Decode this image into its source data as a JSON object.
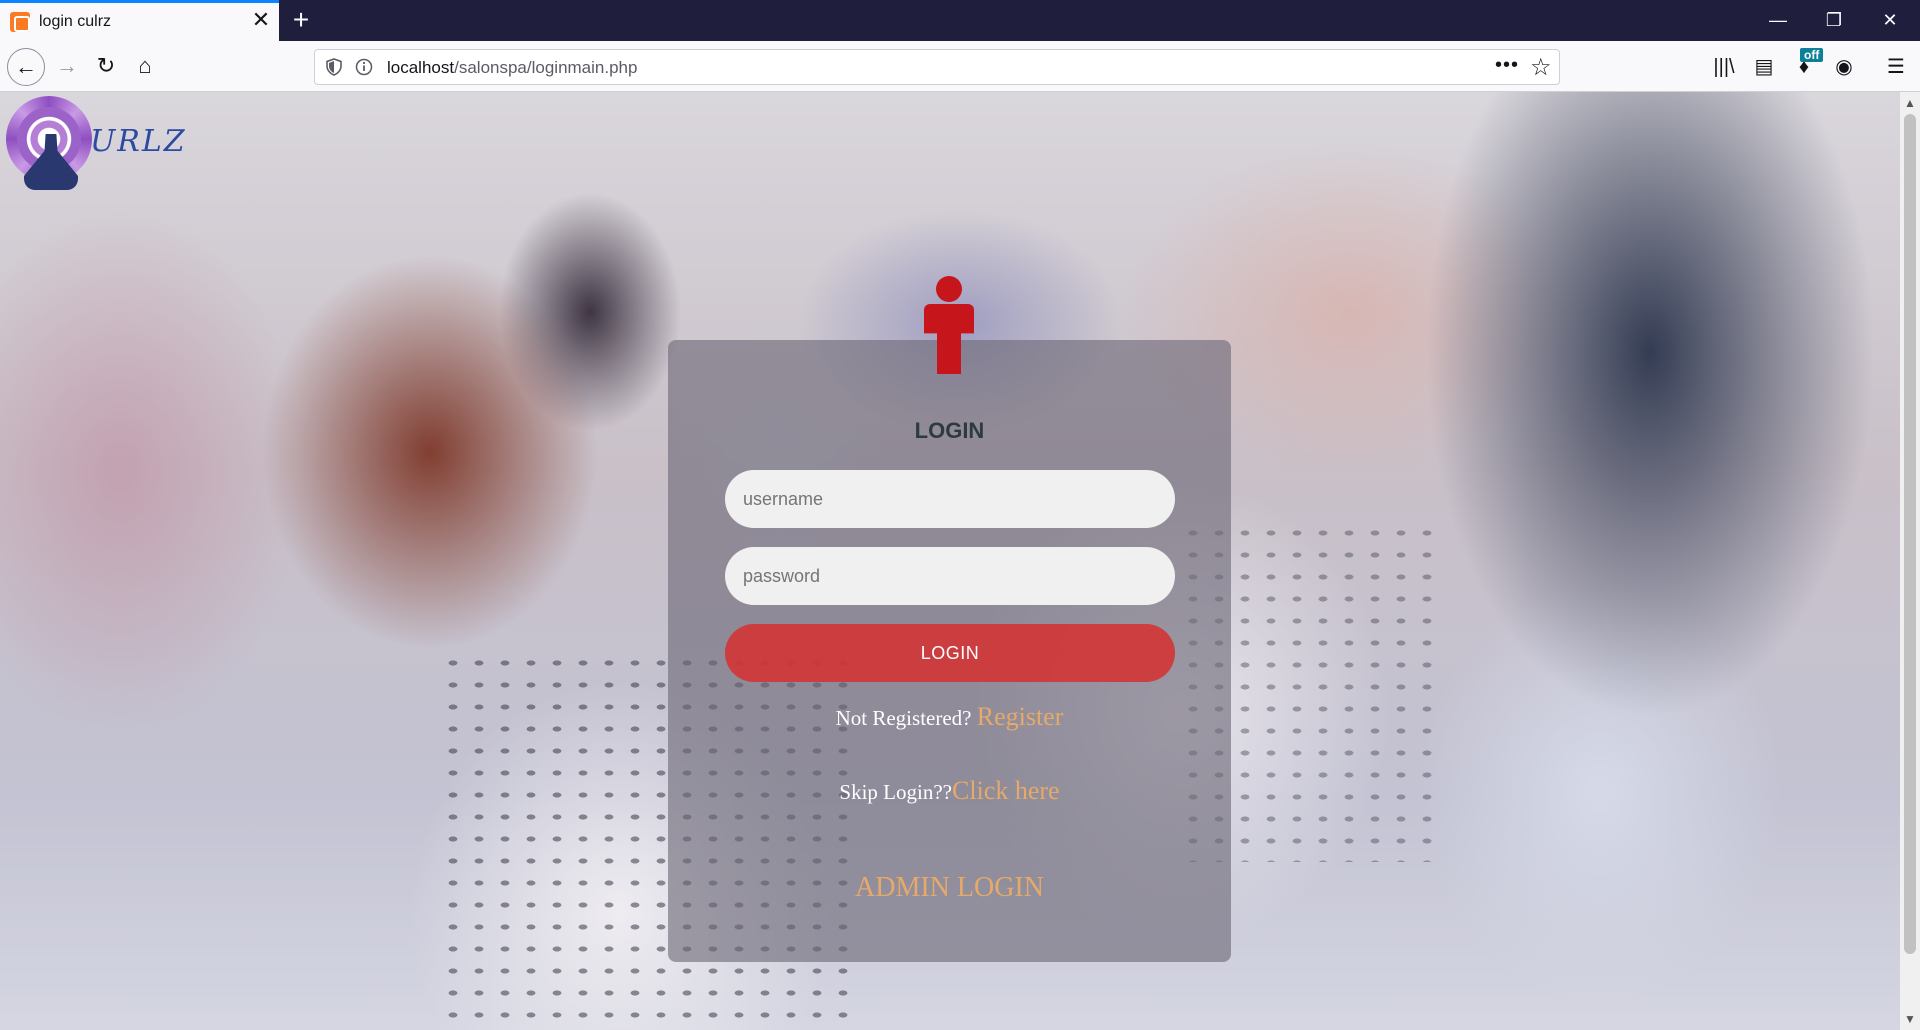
{
  "browser": {
    "tab": {
      "title": "login culrz",
      "close": "✕"
    },
    "new_tab": "+",
    "window": {
      "minimize": "—",
      "restore": "❐",
      "close": "✕"
    },
    "nav": {
      "back": "←",
      "forward": "→",
      "reload": "↻",
      "home": "⌂"
    },
    "url": {
      "host": "localhost",
      "path": "/salonspa/loginmain.php"
    },
    "url_actions": {
      "more": "•••",
      "bookmark": "☆"
    },
    "toolbar": {
      "library": "|||\\",
      "sidebar": "▤",
      "extension": "♦",
      "extension_badge": "off",
      "account": "◉",
      "menu": "☰"
    }
  },
  "logo": {
    "wordmark": "URLZ"
  },
  "login": {
    "heading": "LOGIN",
    "username_placeholder": "username",
    "password_placeholder": "password",
    "button": "LOGIN",
    "register_prompt": "Not Registered? ",
    "register_link": "Register",
    "skip_prompt": "Skip Login??",
    "skip_link": "Click here",
    "admin_link": "ADMIN LOGIN"
  },
  "colors": {
    "accent_red": "#c7151c",
    "login_button": "#d43232",
    "link": "#e7a968",
    "logo_blue": "#2b4aa0",
    "tab_indicator": "#0a84ff"
  },
  "icons": [
    "shield-icon",
    "info-icon",
    "user-icon",
    "mandala-logo-icon"
  ],
  "scrollbar": {
    "up": "▲",
    "down": "▼"
  }
}
